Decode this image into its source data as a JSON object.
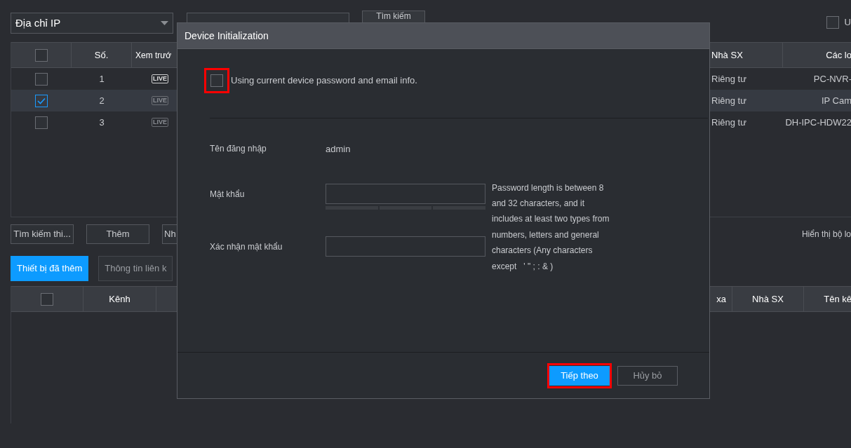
{
  "search_bar": {
    "dropdown": "Địa chỉ IP",
    "search_button": "Tìm kiếm",
    "right_checkbox": {
      "label": "U",
      "checked": false
    }
  },
  "device_table": {
    "columns": [
      "Số.",
      "Xem trướ",
      "Nhà SX",
      "Các lo"
    ],
    "header_checked": false,
    "rows": [
      {
        "checked": false,
        "selected": false,
        "number": "1",
        "preview": "LIVE",
        "preview_enabled": true,
        "vendor": "Riêng tư",
        "type": "PC-NVR-"
      },
      {
        "checked": true,
        "selected": true,
        "number": "2",
        "preview": "LIVE",
        "preview_enabled": false,
        "vendor": "Riêng tư",
        "type": "IP Cam"
      },
      {
        "checked": false,
        "selected": false,
        "number": "3",
        "preview": "LIVE",
        "preview_enabled": false,
        "vendor": "Riêng tư",
        "type": "DH-IPC-HDW22"
      }
    ]
  },
  "actions": [
    "Tìm kiếm thi...",
    "Thêm",
    "Nh"
  ],
  "filter_label": "Hiển thị bộ lo",
  "tabs": [
    {
      "label": "Thiết bị đã thêm",
      "selected": true
    },
    {
      "label": "Thông tin liên k",
      "selected": false
    }
  ],
  "added_table": {
    "header_checked": false,
    "columns": [
      "Kênh",
      "xa",
      "Nhà SX",
      "Tên kê"
    ]
  },
  "dialog": {
    "title": "Device Initialization",
    "use_current": {
      "label": "Using current device password and email info.",
      "checked": false,
      "highlighted": true
    },
    "username": {
      "label": "Tên đăng nhập",
      "value": "admin"
    },
    "password": {
      "label": "Mật khẩu"
    },
    "confirm": {
      "label": "Xác nhận mật khẩu"
    },
    "hint": "Password length is between 8 and 32 characters, and it includes at least two types from numbers, letters and general characters (Any characters except   ' \" ; : & )",
    "buttons": [
      {
        "label": "Tiếp theo",
        "kind": "primary",
        "highlighted": true
      },
      {
        "label": "Hủy bỏ",
        "kind": "secondary",
        "highlighted": false
      }
    ]
  }
}
